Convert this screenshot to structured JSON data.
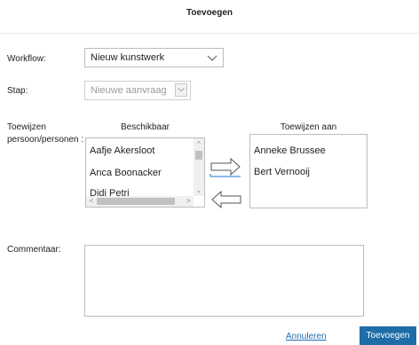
{
  "dialog": {
    "title": "Toevoegen"
  },
  "workflow": {
    "label": "Workflow:",
    "value": "Nieuw kunstwerk"
  },
  "step": {
    "label": "Stap:",
    "value": "Nieuwe aanvraag"
  },
  "assign": {
    "label_line1": "Toewijzen",
    "label_line2": "persoon/personen :",
    "available_header": "Beschikbaar",
    "assigned_header": "Toewijzen aan",
    "available": [
      "Aafje Akersloot",
      "Anca Boonacker",
      "Didi Petri"
    ],
    "assigned": [
      "Anneke Brussee",
      "Bert Vernooij"
    ]
  },
  "comment": {
    "label": "Commentaar:",
    "value": ""
  },
  "footer": {
    "cancel_label": "Annuleren",
    "submit_label": "Toevoegen"
  },
  "colors": {
    "primary": "#1f6da8",
    "link": "#1f6cb0",
    "arrow_active": "#4a90d9"
  },
  "icons": {
    "move_right": "arrow-right-outline-icon",
    "move_left": "arrow-left-outline-icon"
  }
}
